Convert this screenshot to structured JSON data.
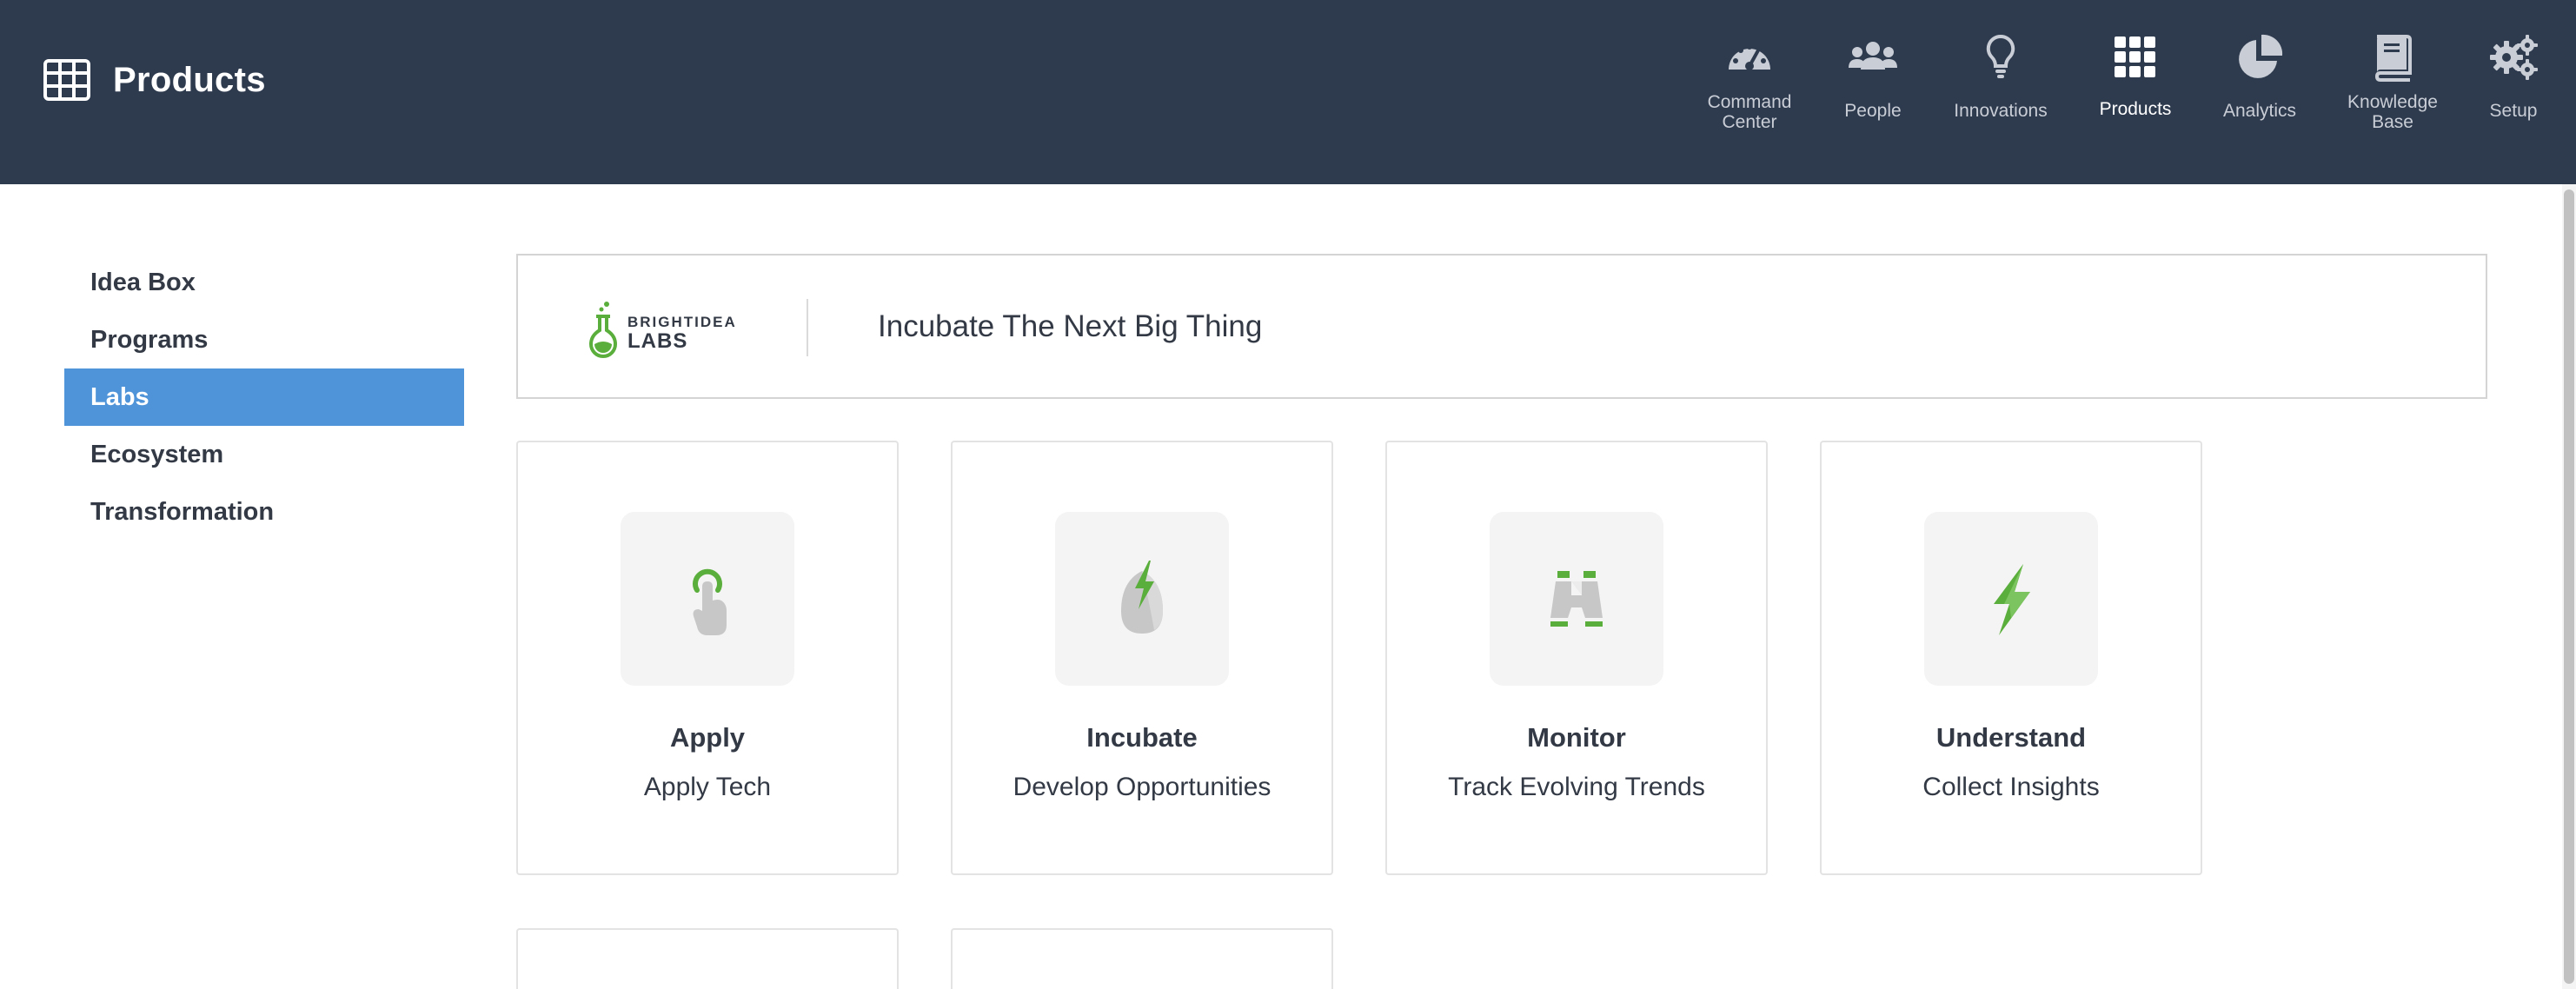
{
  "header": {
    "title": "Products",
    "title_icon": "grid-table-icon"
  },
  "nav": {
    "items": [
      {
        "label": "Command\nCenter",
        "icon": "dashboard-gauge-icon",
        "active": false
      },
      {
        "label": "People",
        "icon": "people-group-icon",
        "active": false
      },
      {
        "label": "Innovations",
        "icon": "lightbulb-icon",
        "active": false
      },
      {
        "label": "Products",
        "icon": "apps-grid-icon",
        "active": true
      },
      {
        "label": "Analytics",
        "icon": "pie-chart-icon",
        "active": false
      },
      {
        "label": "Knowledge\nBase",
        "icon": "book-icon",
        "active": false
      },
      {
        "label": "Setup",
        "icon": "gears-icon",
        "active": false
      }
    ]
  },
  "sidebar": {
    "items": [
      {
        "label": "Idea Box",
        "active": false
      },
      {
        "label": "Programs",
        "active": false
      },
      {
        "label": "Labs",
        "active": true
      },
      {
        "label": "Ecosystem",
        "active": false
      },
      {
        "label": "Transformation",
        "active": false
      }
    ]
  },
  "banner": {
    "logo_text_top": "BRIGHTIDEA",
    "logo_text_bottom": "LABS",
    "tagline": "Incubate The Next Big Thing"
  },
  "cards": [
    {
      "title": "Apply",
      "subtitle": "Apply Tech",
      "icon": "touch-hand-icon"
    },
    {
      "title": "Incubate",
      "subtitle": "Develop Opportunities",
      "icon": "egg-lightning-icon"
    },
    {
      "title": "Monitor",
      "subtitle": "Track Evolving Trends",
      "icon": "binoculars-icon"
    },
    {
      "title": "Understand",
      "subtitle": "Collect Insights",
      "icon": "lightning-bolt-icon"
    }
  ],
  "colors": {
    "header_bg": "#2e3a4e",
    "accent_blue": "#4f94d8",
    "brand_green": "#5aae3b",
    "text_dark": "#333a45"
  }
}
